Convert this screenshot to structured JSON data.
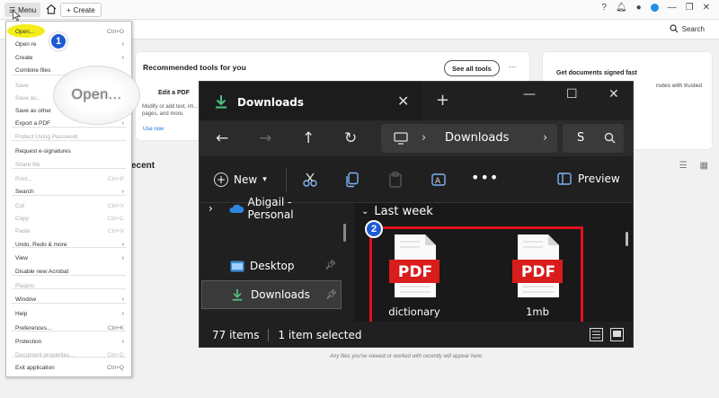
{
  "acrobat": {
    "menu_label": "Menu",
    "create_label": "Create",
    "search_label": "Search",
    "recommended_title": "Recommended tools for you",
    "see_all_label": "See all tools",
    "more": "...",
    "edit_pdf_title": "Edit a PDF",
    "edit_pdf_desc": "Modify or add text, im... pages, and more.",
    "use_now": "Use now",
    "signed_title": "Get documents signed fast",
    "signed_desc": "nutes with trusted",
    "recent_label": "ecent",
    "empty_text": "Any files you've viewed or worked with recently will appear here."
  },
  "menu": {
    "items": [
      {
        "label": "Open...",
        "shortcut": "Ctrl+O",
        "disabled": false
      },
      {
        "label": "Open re",
        "shortcut": "",
        "arrow": true,
        "disabled": false
      },
      {
        "label": "Create",
        "shortcut": "",
        "arrow": true,
        "disabled": false
      },
      {
        "label": "Combine files",
        "shortcut": "",
        "disabled": false
      },
      {
        "label": "Save",
        "shortcut": "",
        "disabled": true
      },
      {
        "label": "Save as...",
        "shortcut": "",
        "disabled": true
      },
      {
        "label": "Save as other",
        "shortcut": "",
        "arrow": true,
        "disabled": false
      },
      {
        "label": "Export a PDF",
        "shortcut": "",
        "arrow": true,
        "disabled": false
      },
      {
        "label": "Protect Using Password",
        "shortcut": "",
        "disabled": true
      },
      {
        "label": "Request e-signatures",
        "shortcut": "",
        "disabled": false
      },
      {
        "label": "Share file",
        "shortcut": "",
        "disabled": true
      },
      {
        "label": "Print...",
        "shortcut": "Ctrl+P",
        "disabled": true
      },
      {
        "label": "Search",
        "shortcut": "",
        "arrow": true,
        "disabled": false
      },
      {
        "label": "Cut",
        "shortcut": "Ctrl+X",
        "disabled": true
      },
      {
        "label": "Copy",
        "shortcut": "Ctrl+C",
        "disabled": true
      },
      {
        "label": "Paste",
        "shortcut": "Ctrl+V",
        "disabled": true
      },
      {
        "label": "Undo, Redo & more",
        "shortcut": "",
        "arrow": true,
        "disabled": false
      },
      {
        "label": "View",
        "shortcut": "",
        "arrow": true,
        "disabled": false
      },
      {
        "label": "Disable new Acrobat",
        "shortcut": "",
        "disabled": false
      },
      {
        "label": "Plugins",
        "shortcut": "",
        "disabled": true
      },
      {
        "label": "Window",
        "shortcut": "",
        "arrow": true,
        "disabled": false
      },
      {
        "label": "Help",
        "shortcut": "",
        "arrow": true,
        "disabled": false
      },
      {
        "label": "Preferences...",
        "shortcut": "Ctrl+K",
        "disabled": false
      },
      {
        "label": "Protection",
        "shortcut": "",
        "arrow": true,
        "disabled": false
      },
      {
        "label": "Document properties...",
        "shortcut": "Ctrl+D",
        "disabled": true
      },
      {
        "label": "Exit application",
        "shortcut": "Ctrl+Q",
        "disabled": false
      }
    ]
  },
  "magnifier_text": "Open...",
  "badges": [
    "1",
    "2"
  ],
  "explorer": {
    "tab_title": "Downloads",
    "address_folder": "Downloads",
    "search_placeholder": "S",
    "new_label": "New",
    "preview_label": "Preview",
    "sidebar": [
      {
        "label": "Abigail - Personal"
      },
      {
        "label": "Desktop"
      },
      {
        "label": "Downloads"
      }
    ],
    "group_label": "Last week",
    "files": [
      {
        "icon_text": "PDF",
        "name": "dictionary"
      },
      {
        "icon_text": "PDF",
        "name": "1mb"
      }
    ],
    "status_items": "77 items",
    "status_selected": "1 item selected"
  },
  "colors": {
    "highlight": "#f3ee1b",
    "badge": "#1e5bd4",
    "red_box": "#e01020",
    "pdf_red": "#d91c1c"
  }
}
